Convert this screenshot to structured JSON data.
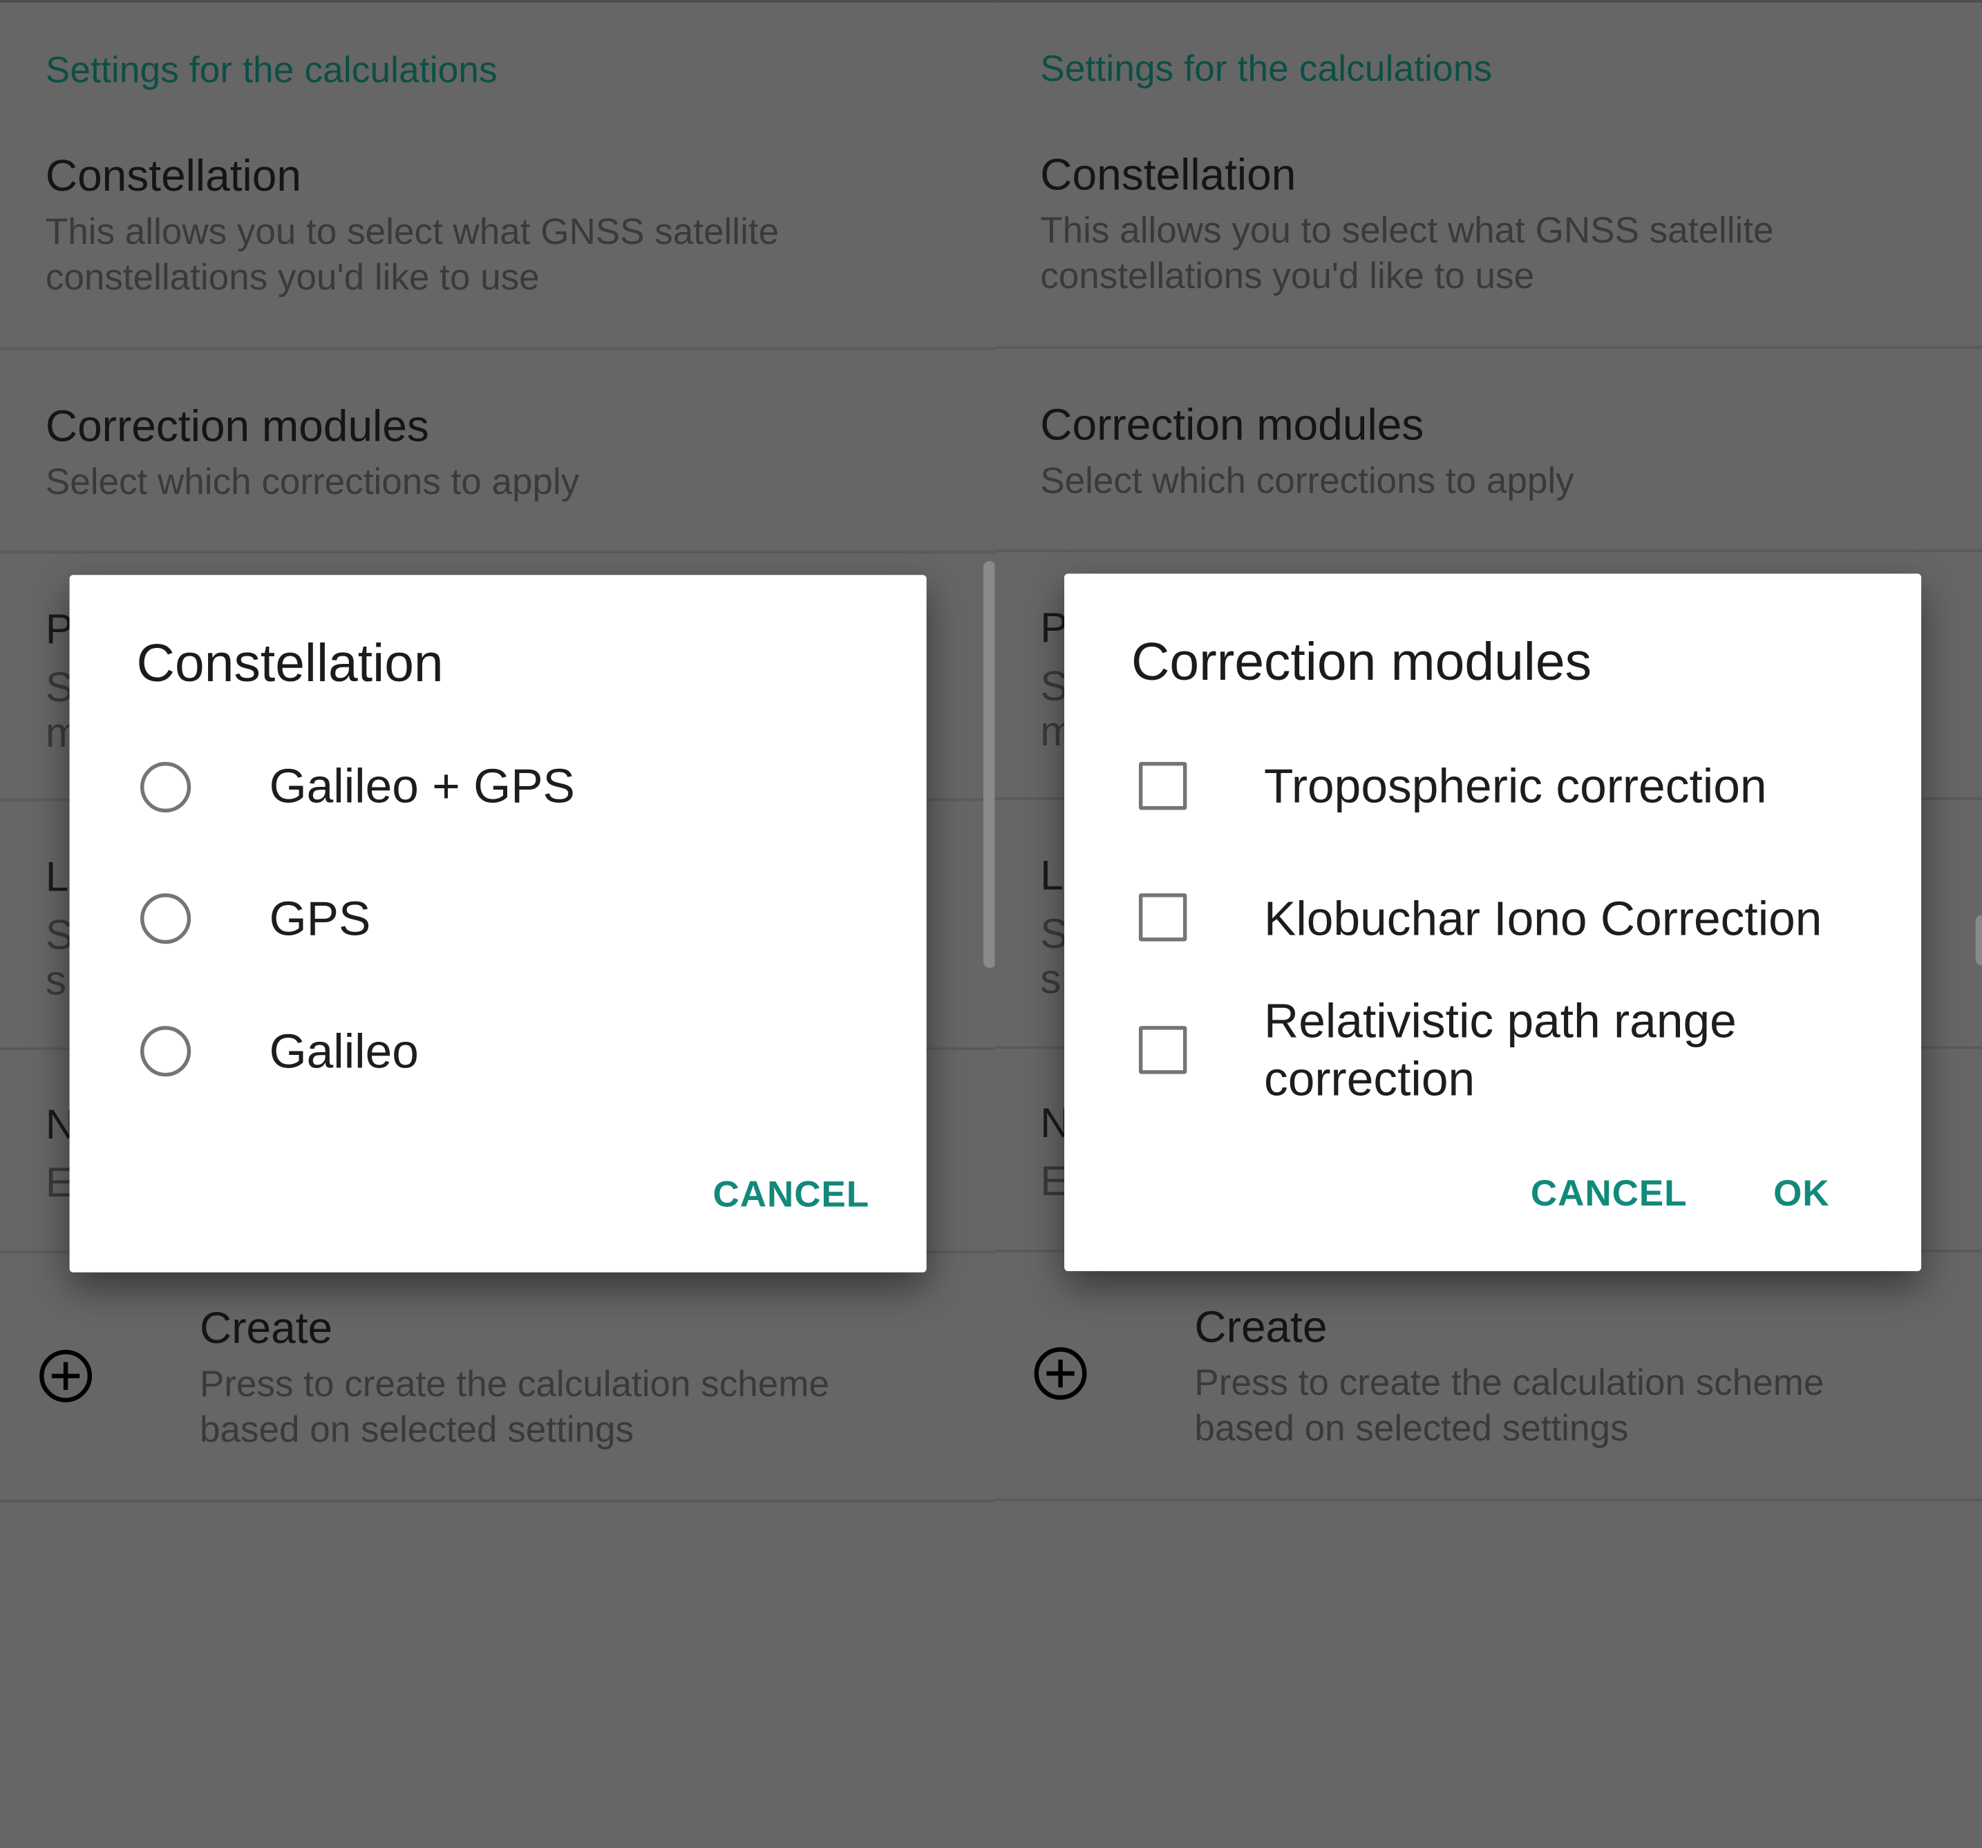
{
  "category_header": "Settings for the calculations",
  "prefs": {
    "constellation": {
      "title": "Constellation",
      "summary_line1": "This allows you to select what GNSS satellite",
      "summary_line2": "constellations you'd like to use"
    },
    "correction_modules": {
      "title": "Correction modules",
      "summary": "Select which corrections to apply"
    },
    "partially_hidden_letters": [
      "P",
      "S",
      "m",
      "L",
      "S",
      "s",
      "N",
      "E"
    ],
    "create": {
      "title": "Create",
      "summary_line1": "Press to create the calculation scheme",
      "summary_line2": "based on selected settings",
      "icon": "add-circle-icon"
    }
  },
  "constellation_dialog": {
    "title": "Constellation",
    "options": [
      {
        "label": "Galileo + GPS",
        "selected": false
      },
      {
        "label": "GPS",
        "selected": false
      },
      {
        "label": "Galileo",
        "selected": false
      }
    ],
    "cancel_label": "CANCEL"
  },
  "correction_dialog": {
    "title": "Correction modules",
    "options": [
      {
        "label": "Tropospheric correction",
        "checked": false
      },
      {
        "label": "Klobuchar Iono Correction",
        "checked": false
      },
      {
        "label_line1": "Relativistic path range",
        "label_line2": "correction",
        "checked": false
      }
    ],
    "cancel_label": "CANCEL",
    "ok_label": "OK"
  },
  "colors": {
    "accent": "#12897b",
    "category": "#0c4f45",
    "scrim_background": "#666666",
    "dialog_background": "#ffffff"
  }
}
